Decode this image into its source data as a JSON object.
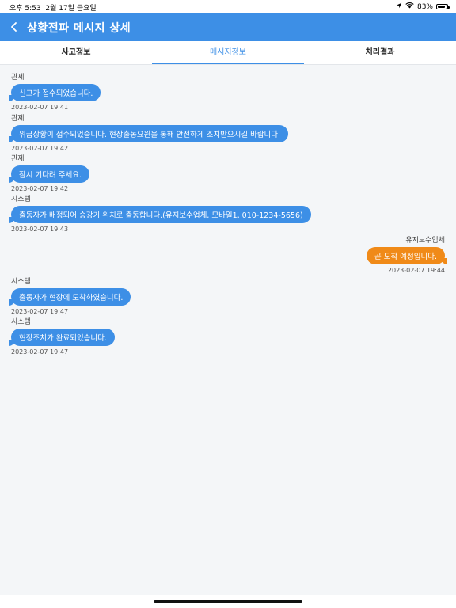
{
  "status_bar": {
    "time": "오후 5:53",
    "date": "2월 17일 금요일",
    "battery_percent": "83%",
    "battery_level": 0.83
  },
  "header": {
    "title": "상황전파 메시지 상세",
    "back_icon": "chevron-left-icon"
  },
  "tabs": [
    {
      "label": "사고정보",
      "active": false
    },
    {
      "label": "메시지정보",
      "active": true
    },
    {
      "label": "처리결과",
      "active": false
    }
  ],
  "messages": [
    {
      "sender": "관제",
      "text": "신고가 접수되었습니다.",
      "time": "2023-02-07 19:41",
      "side": "left"
    },
    {
      "sender": "관제",
      "text": "위급상황이 접수되었습니다. 현장출동요원을 통해 안전하게 조치받으시길 바랍니다.",
      "time": "2023-02-07 19:42",
      "side": "left"
    },
    {
      "sender": "관제",
      "text": "잠시 기다려 주세요.",
      "time": "2023-02-07 19:42",
      "side": "left"
    },
    {
      "sender": "시스템",
      "text": "출동자가 배정되어 승강기 위치로 출동합니다.(유지보수업체, 모바일1, 010-1234-5656)",
      "time": "2023-02-07 19:43",
      "side": "left"
    },
    {
      "sender": "유지보수업체",
      "text": "곧 도착 예정입니다.",
      "time": "2023-02-07 19:44",
      "side": "right"
    },
    {
      "sender": "시스템",
      "text": "출동자가 현장에 도착하였습니다.",
      "time": "2023-02-07 19:47",
      "side": "left"
    },
    {
      "sender": "시스템",
      "text": "현장조치가 완료되었습니다.",
      "time": "2023-02-07 19:47",
      "side": "left"
    }
  ],
  "colors": {
    "primary": "#3d8fe6",
    "reply_bubble": "#f08a18",
    "background": "#f4f6f8"
  }
}
